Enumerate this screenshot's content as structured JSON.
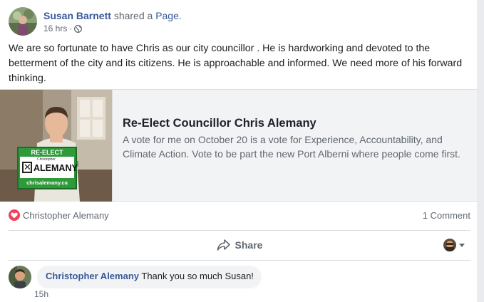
{
  "post": {
    "author": "Susan Barnett",
    "action": "shared a",
    "object": "Page.",
    "time": "16 hrs",
    "dot": "·",
    "body": "We are so fortunate to have Chris as our city councillor . He is hardworking and devoted to the betterment of the city and its citizens. He is approachable and informed. We need more of his forward thinking."
  },
  "link_card": {
    "title": "Re-Elect Councillor Chris Alemany",
    "description": "A vote for me on October 20 is a vote for Experience, Accountability, and Climate Action. Vote to be part the new Port Alberni where people come first.",
    "sign": {
      "top": "RE-ELECT",
      "small": "Christopher",
      "name": "ALEMANY",
      "site": "chrisalemany.ca"
    }
  },
  "reactions": {
    "reactor": "Christopher Alemany",
    "comments": "1 Comment"
  },
  "actions": {
    "share_label": "Share"
  },
  "comment": {
    "author": "Christopher Alemany",
    "text": "Thank you so much Susan!",
    "time": "15h"
  },
  "colors": {
    "link": "#385898",
    "secondary": "#606770",
    "love": "#f33e58",
    "card_bg": "#f2f3f5"
  }
}
